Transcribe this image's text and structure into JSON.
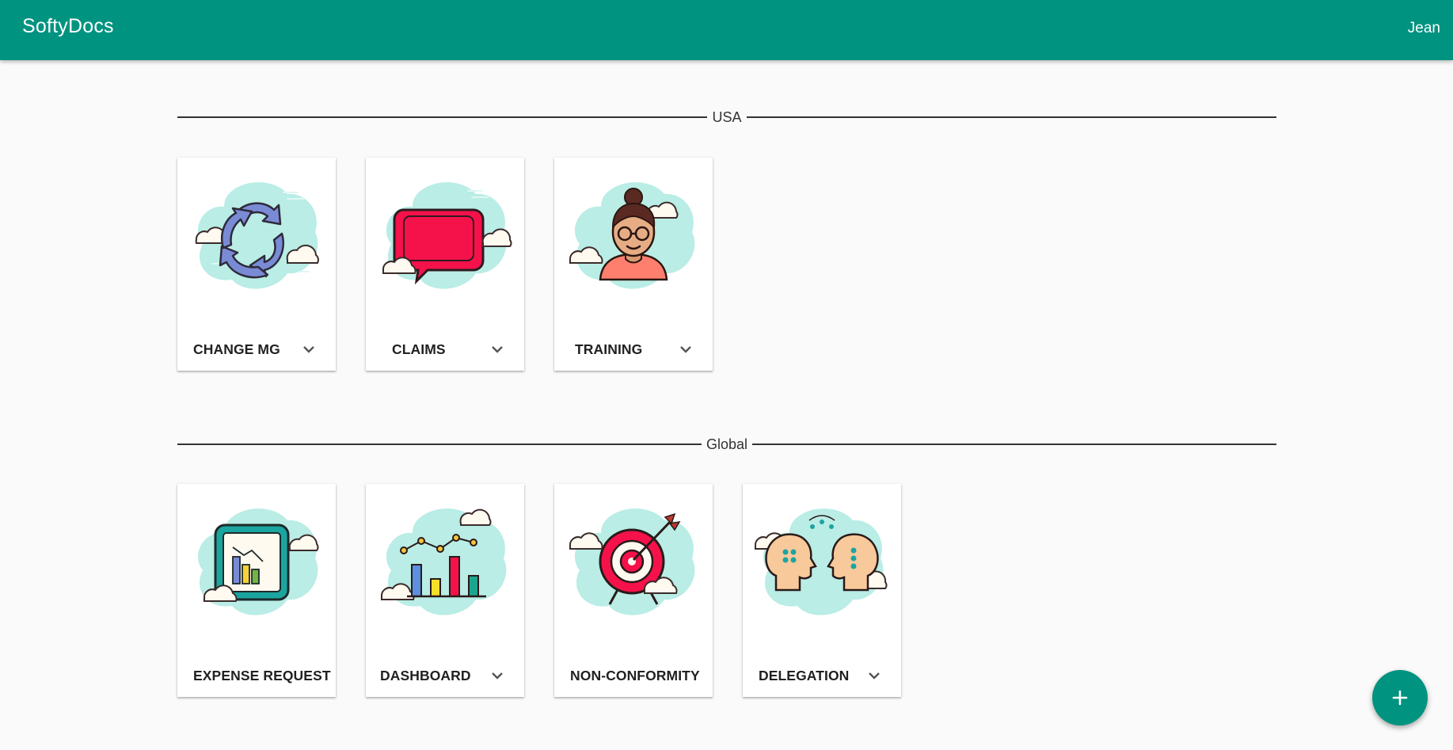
{
  "app": {
    "title": "SoftyDocs",
    "user": "Jean"
  },
  "sections": [
    {
      "label": "USA",
      "cards": [
        {
          "title": "CHANGE MG",
          "icon": "cycle-arrows-icon",
          "has_menu": true
        },
        {
          "title": "CLAIMS",
          "icon": "speech-bubble-icon",
          "has_menu": true
        },
        {
          "title": "TRAINING",
          "icon": "woman-avatar-icon",
          "has_menu": true
        }
      ]
    },
    {
      "label": "Global",
      "cards": [
        {
          "title": "EXPENSE REQUEST",
          "icon": "report-chart-icon",
          "has_menu": false
        },
        {
          "title": "DASHBOARD",
          "icon": "bar-chart-icon",
          "has_menu": true
        },
        {
          "title": "NON-CONFORMITY",
          "icon": "target-arrow-icon",
          "has_menu": false
        },
        {
          "title": "DELEGATION",
          "icon": "two-heads-icon",
          "has_menu": true
        }
      ]
    }
  ],
  "fab": {
    "icon": "plus-icon"
  },
  "colors": {
    "primary": "#009380",
    "cloud": "#b9ede5",
    "background": "#fafafa"
  }
}
